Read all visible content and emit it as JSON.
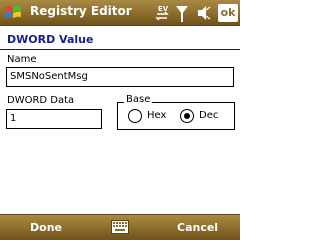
{
  "titlebar": {
    "title": "Registry Editor",
    "tray_ev_label": "EV",
    "ok_label": "ok"
  },
  "dialog": {
    "title": "DWORD Value",
    "name_label": "Name",
    "name_value": "SMSNoSentMsg",
    "data_label": "DWORD Data",
    "data_value": "1",
    "base_label": "Base",
    "hex_label": "Hex",
    "dec_label": "Dec",
    "selected_base": "Dec"
  },
  "softkeys": {
    "left": "Done",
    "right": "Cancel"
  },
  "colors": {
    "bar": "#8c6c2a",
    "title_text": "#16208c",
    "text": "#000000"
  }
}
